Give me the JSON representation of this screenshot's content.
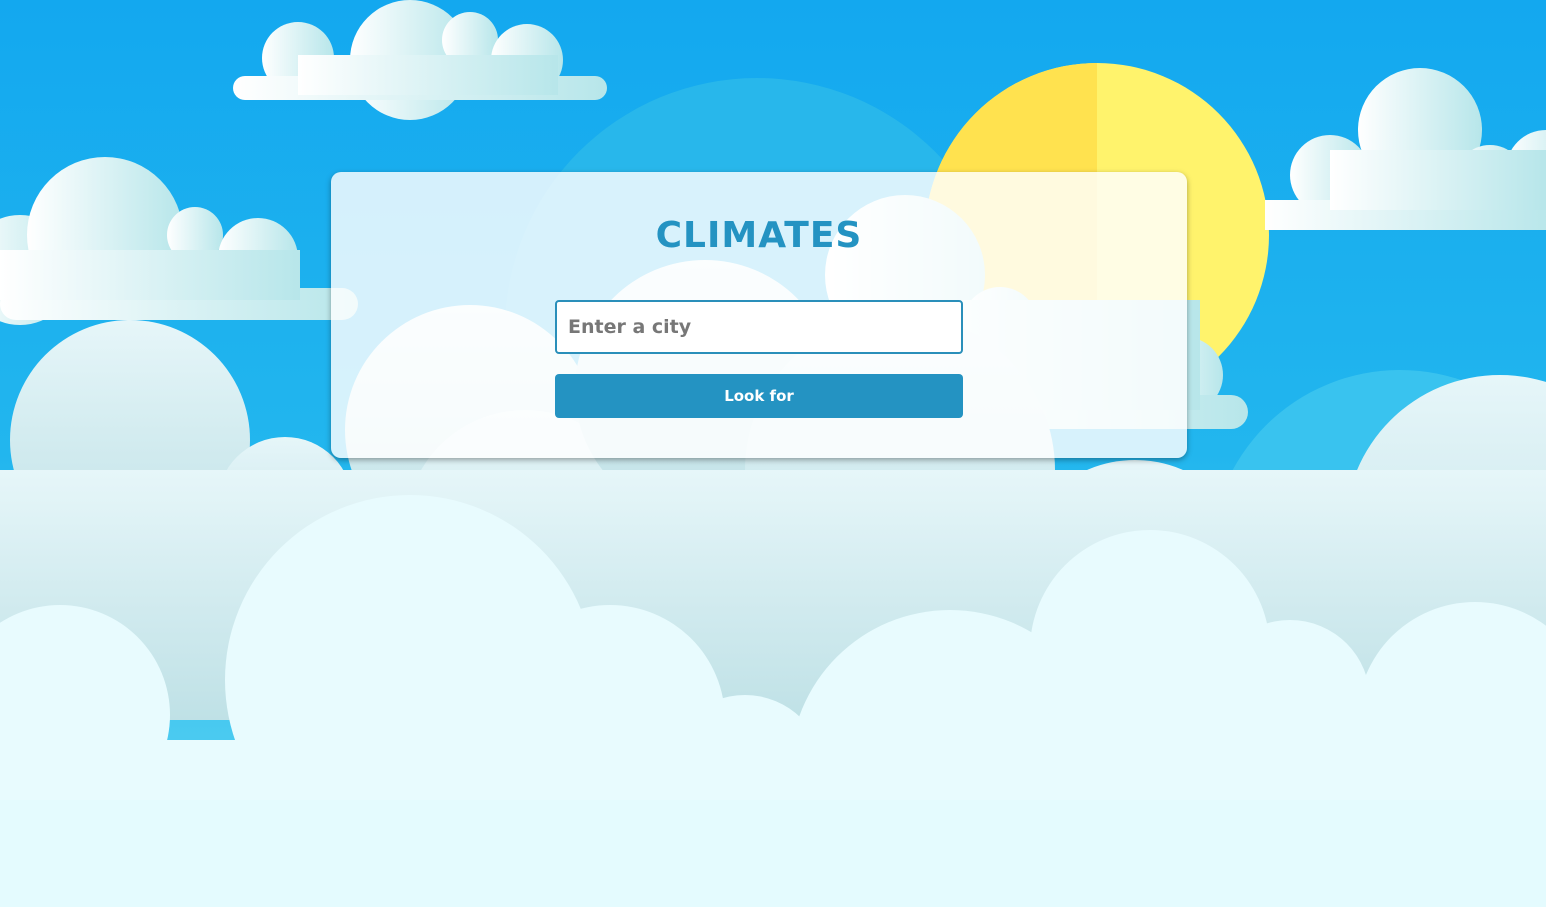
{
  "app": {
    "title": "CLIMATES"
  },
  "search": {
    "value": "",
    "placeholder": "Enter a city",
    "button_label": "Look for"
  },
  "colors": {
    "accent": "#2493c2",
    "sky_top": "#15a9ee",
    "sky_bottom": "#5fd2f0",
    "sun": "#fff176",
    "cloud": "#e8fbff"
  },
  "background": {
    "scene": "sky-with-clouds-and-sun",
    "icons": [
      "sun-icon",
      "cloud-icon"
    ]
  }
}
